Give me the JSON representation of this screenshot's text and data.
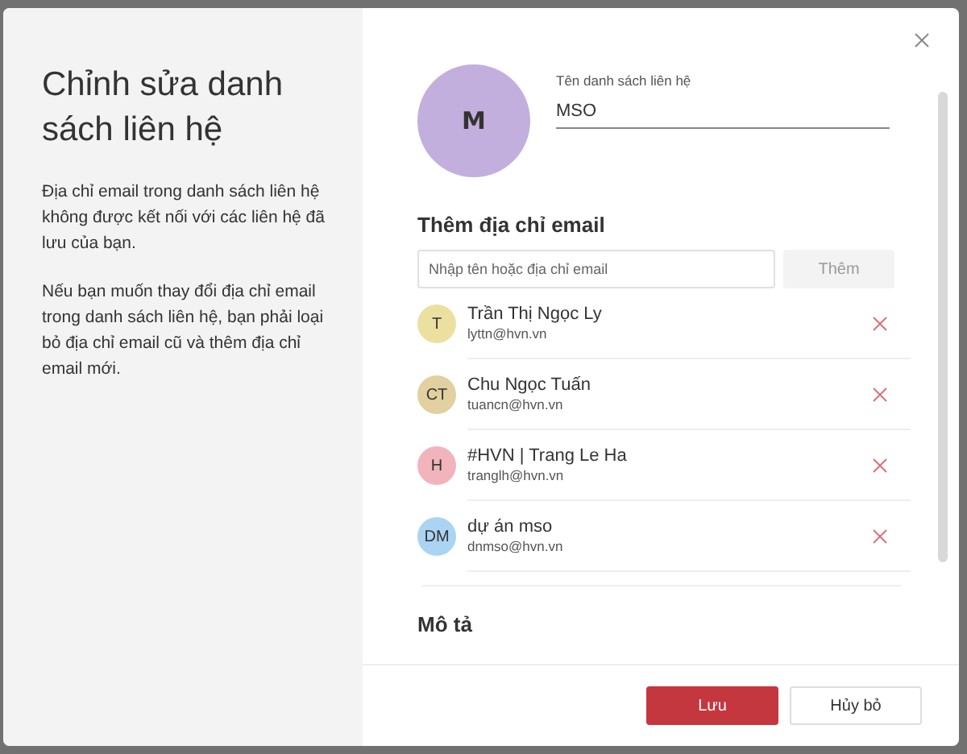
{
  "intro": {
    "title": "Chỉnh sửa danh sách liên hệ",
    "paragraphs": [
      "Địa chỉ email trong danh sách liên hệ không được kết nối với các liên hệ đã lưu của bạn.",
      "Nếu bạn muốn thay đổi địa chỉ email trong danh sách liên hệ, bạn phải loại bỏ địa chỉ email cũ và thêm địa chỉ email mới."
    ]
  },
  "list": {
    "avatar": "M",
    "name_label": "Tên danh sách liên hệ",
    "name_value": "MSO"
  },
  "add_email": {
    "heading": "Thêm địa chỉ email",
    "placeholder": "Nhập tên hoặc địa chỉ email",
    "button": {
      "label": "Thêm",
      "disabled": true
    }
  },
  "contacts": [
    {
      "initials": "T",
      "name": "Trần Thị Ngọc Ly",
      "email": "lyttn@hvn.vn",
      "color": "#ece0a0"
    },
    {
      "initials": "CT",
      "name": "Chu Ngọc Tuấn",
      "email": "tuancn@hvn.vn",
      "color": "#e2d0a0"
    },
    {
      "initials": "H",
      "name": "#HVN | Trang Le Ha",
      "email": "tranglh@hvn.vn",
      "color": "#f2b4bc"
    },
    {
      "initials": "DM",
      "name": "dự án mso",
      "email": "dnmso@hvn.vn",
      "color": "#aad4f2"
    }
  ],
  "description": {
    "heading": "Mô tả"
  },
  "buttons": [
    {
      "label": "Lưu",
      "kind": "primary"
    },
    {
      "label": "Hủy bỏ",
      "kind": "secondary"
    }
  ]
}
